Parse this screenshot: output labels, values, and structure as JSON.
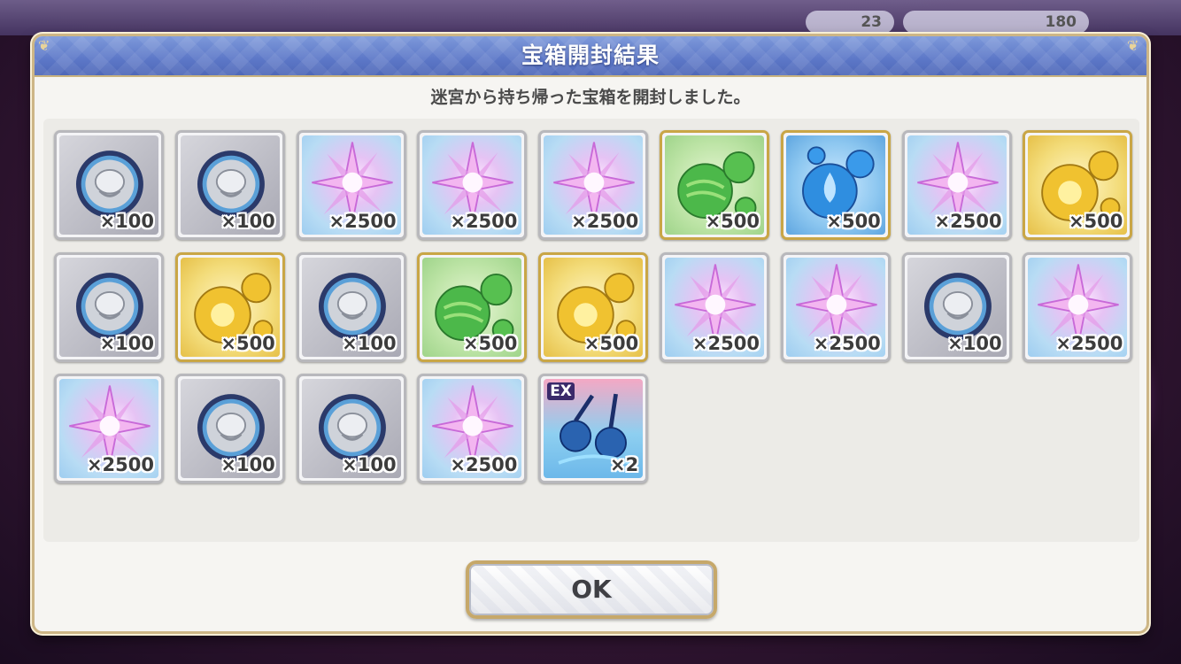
{
  "background_hud": {
    "value_a": "23",
    "value_b": "180"
  },
  "dialog": {
    "title": "宝箱開封結果",
    "message": "迷宮から持ち帰った宝箱を開封しました。",
    "ok_label": "OK"
  },
  "items": [
    {
      "type": "silver-medal",
      "qty": "×100"
    },
    {
      "type": "silver-medal",
      "qty": "×100"
    },
    {
      "type": "crystal",
      "qty": "×2500"
    },
    {
      "type": "crystal",
      "qty": "×2500"
    },
    {
      "type": "crystal",
      "qty": "×2500"
    },
    {
      "type": "green-orb",
      "qty": "×500"
    },
    {
      "type": "blue-orb",
      "qty": "×500"
    },
    {
      "type": "crystal",
      "qty": "×2500"
    },
    {
      "type": "gold-orb",
      "qty": "×500"
    },
    {
      "type": "silver-medal",
      "qty": "×100"
    },
    {
      "type": "gold-orb",
      "qty": "×500"
    },
    {
      "type": "silver-medal",
      "qty": "×100"
    },
    {
      "type": "green-orb",
      "qty": "×500"
    },
    {
      "type": "gold-orb",
      "qty": "×500"
    },
    {
      "type": "crystal",
      "qty": "×2500"
    },
    {
      "type": "crystal",
      "qty": "×2500"
    },
    {
      "type": "silver-medal",
      "qty": "×100"
    },
    {
      "type": "crystal",
      "qty": "×2500"
    },
    {
      "type": "crystal",
      "qty": "×2500"
    },
    {
      "type": "silver-medal",
      "qty": "×100"
    },
    {
      "type": "silver-medal",
      "qty": "×100"
    },
    {
      "type": "crystal",
      "qty": "×2500"
    },
    {
      "type": "ex-equipment",
      "qty": "×2",
      "badge": "EX"
    }
  ]
}
